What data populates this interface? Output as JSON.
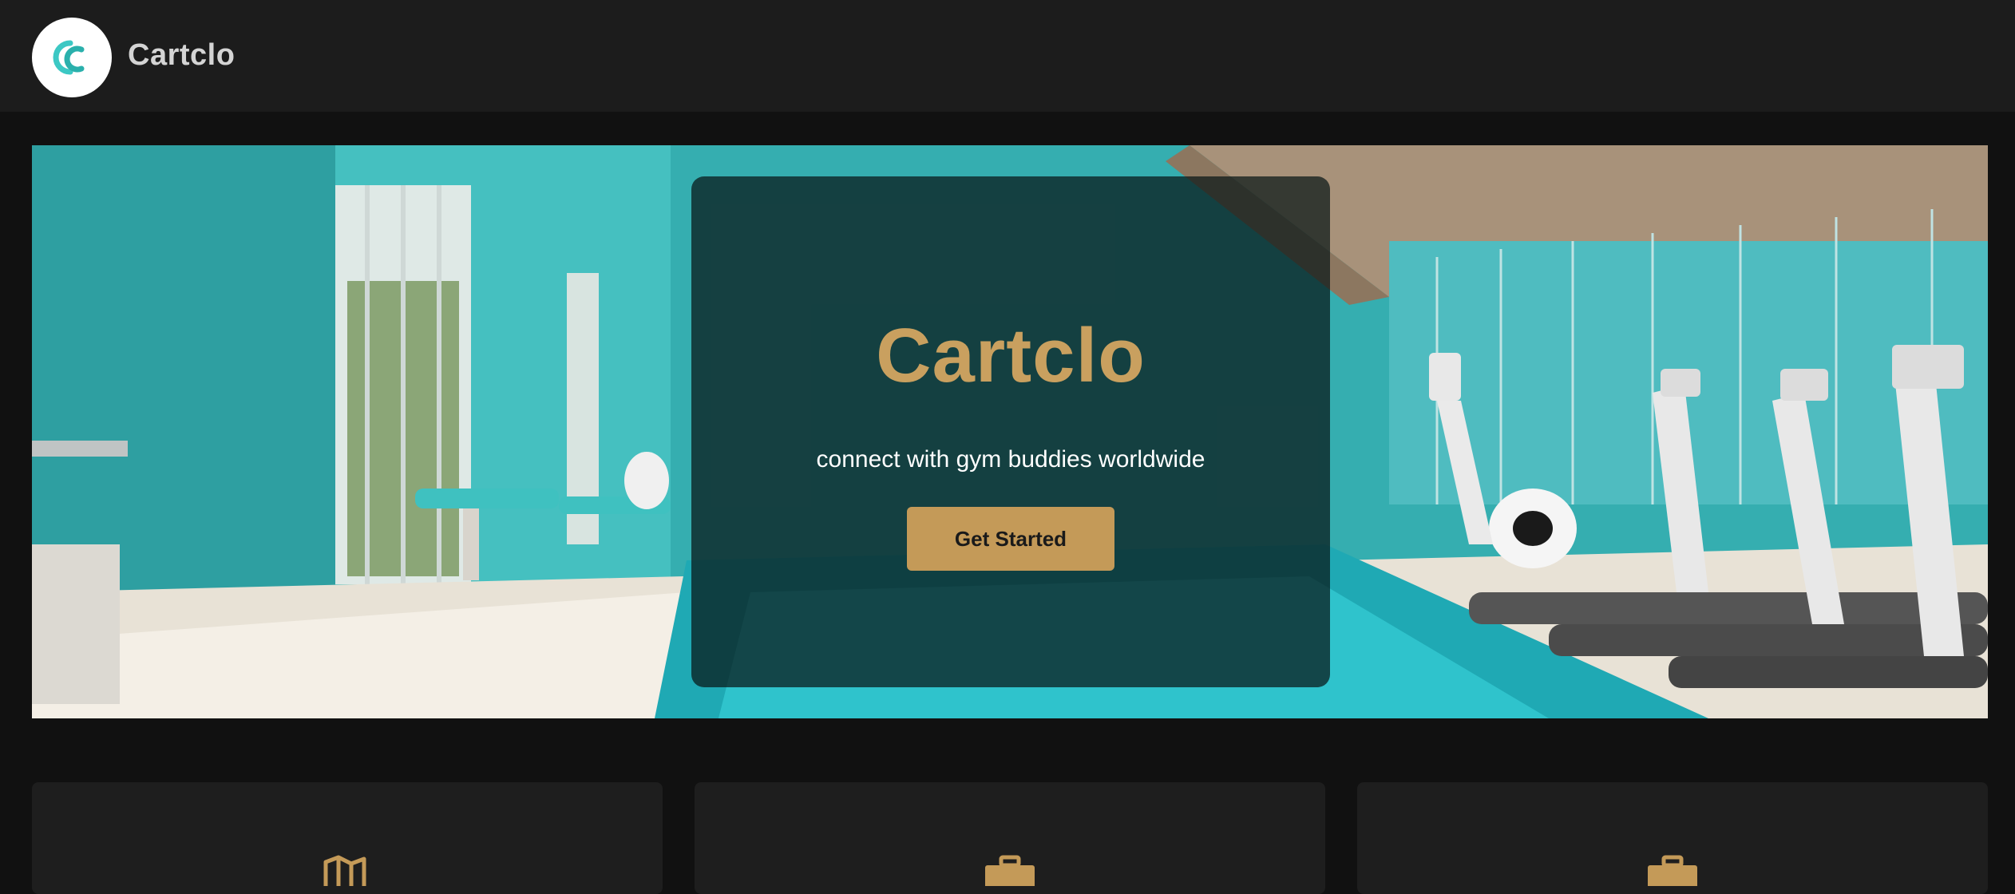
{
  "header": {
    "brand": "Cartclo",
    "logo_icon": "cc-logo-icon"
  },
  "hero": {
    "title": "Cartclo",
    "subtitle": "connect with gym buddies worldwide",
    "cta_label": "Get Started"
  },
  "features": {
    "cards": [
      {
        "icon": "map-icon"
      },
      {
        "icon": "briefcase-icon"
      },
      {
        "icon": "briefcase-icon"
      }
    ]
  },
  "colors": {
    "accent": "#c49a58",
    "background": "#111111",
    "header_bg": "#1c1c1c",
    "card_bg": "#1e1e1e",
    "logo_teal": "#3cc8c4"
  }
}
